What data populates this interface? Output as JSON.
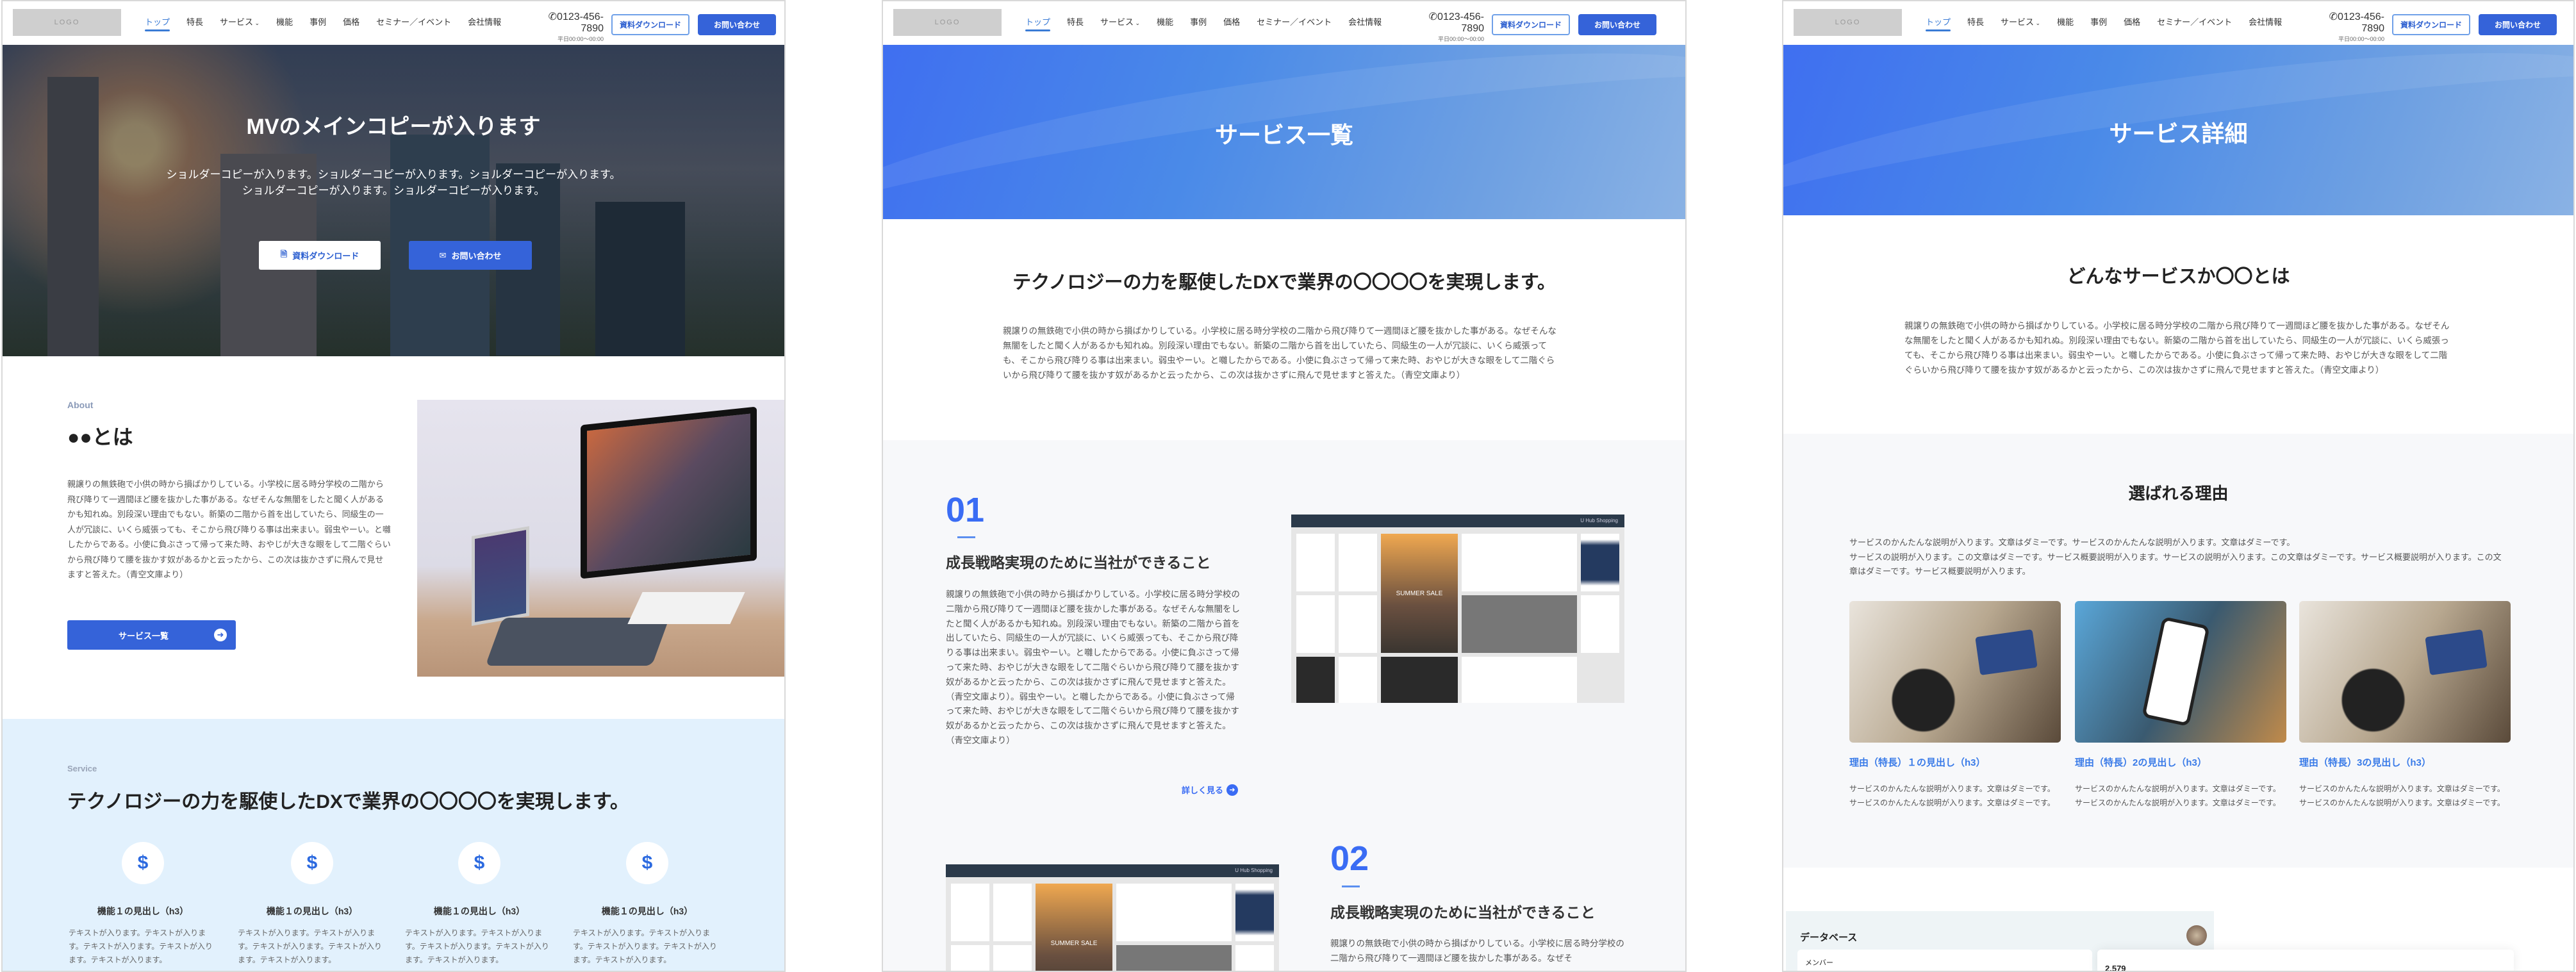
{
  "header": {
    "logo": "LOGO",
    "nav": [
      "トップ",
      "特長",
      "サービス",
      "機能",
      "事例",
      "価格",
      "セミナー／イベント",
      "会社情報"
    ],
    "active_nav": "トップ",
    "phone": "0123-456-7890",
    "hours": "平日00:00〜00:00",
    "download_label": "資料ダウンロード",
    "contact_label": "お問い合わせ",
    "accent": "#3563d9"
  },
  "top_page": {
    "hero": {
      "title": "MVのメインコピーが入ります",
      "sub1": "ショルダーコピーが入ります。ショルダーコピーが入ります。ショルダーコピーが入ります。",
      "sub2": "ショルダーコピーが入ります。ショルダーコピーが入ります。",
      "download_label": "資料ダウンロード",
      "contact_label": "お問い合わせ"
    },
    "about": {
      "eyebrow": "About",
      "title": "●●とは",
      "body": "親譲りの無鉄砲で小供の時から損ばかりしている。小学校に居る時分学校の二階から飛び降りて一週間ほど腰を抜かした事がある。なぜそんな無闇をしたと聞く人があるかも知れぬ。別段深い理由でもない。新築の二階から首を出していたら、同級生の一人が冗談に、いくら威張っても、そこから飛び降りる事は出来まい。弱虫やーい。と囃したからである。小使に負ぶさって帰って来た時、おやじが大きな眼をして二階ぐらいから飛び降りて腰を抜かす奴があるかと云ったから、この次は抜かさずに飛んで見せますと答えた。（青空文庫より）",
      "button": "サービス一覧"
    },
    "service": {
      "eyebrow": "Service",
      "title": "テクノロジーの力を駆使したDXで業界の〇〇〇〇を実現します。",
      "features": [
        {
          "title": "機能１の見出し（h3）",
          "text": "テキストが入ります。テキストが入ります。テキストが入ります。テキストが入ります。テキストが入ります。"
        },
        {
          "title": "機能１の見出し（h3）",
          "text": "テキストが入ります。テキストが入ります。テキストが入ります。テキストが入ります。テキストが入ります。"
        },
        {
          "title": "機能１の見出し（h3）",
          "text": "テキストが入ります。テキストが入ります。テキストが入ります。テキストが入ります。テキストが入ります。"
        },
        {
          "title": "機能１の見出し（h3）",
          "text": "テキストが入ります。テキストが入ります。テキストが入ります。テキストが入ります。テキストが入ります。"
        }
      ]
    }
  },
  "service_list": {
    "hero_title": "サービス一覧",
    "intro_title": "テクノロジーの力を駆使したDXで業界の〇〇〇〇を実現します。",
    "intro_body": "親譲りの無鉄砲で小供の時から損ばかりしている。小学校に居る時分学校の二階から飛び降りて一週間ほど腰を抜かした事がある。なぜそんな無闇をしたと聞く人があるかも知れぬ。別段深い理由でもない。新築の二階から首を出していたら、同級生の一人が冗談に、いくら威張っても、そこから飛び降りる事は出来まい。弱虫やーい。と囃したからである。小使に負ぶさって帰って来た時、おやじが大きな眼をして二階ぐらいから飛び降りて腰を抜かす奴があるかと云ったから、この次は抜かさずに飛んで見せますと答えた。（青空文庫より）",
    "items": [
      {
        "number": "01",
        "title": "成長戦略実現のために当社ができること",
        "body": "親譲りの無鉄砲で小供の時から損ばかりしている。小学校に居る時分学校の二階から飛び降りて一週間ほど腰を抜かした事がある。なぜそんな無闇をしたと聞く人があるかも知れぬ。別段深い理由でもない。新築の二階から首を出していたら、同級生の一人が冗談に、いくら威張っても、そこから飛び降りる事は出来まい。弱虫やーい。と囃したからである。小使に負ぶさって帰って来た時、おやじが大きな眼をして二階ぐらいから飛び降りて腰を抜かす奴があるかと云ったから、この次は抜かさずに飛んで見せますと答えた。（青空文庫より）。弱虫やーい。と囃したからである。小使に負ぶさって帰って来た時、おやじが大きな眼をして二階ぐらいから飛び降りて腰を抜かす奴があるかと云ったから、この次は抜かさずに飛んで見せますと答えた。（青空文庫より）",
        "more": "詳しく見る",
        "shop_brand": "U Hub Shopping",
        "shop_banner": "SUMMER SALE"
      },
      {
        "number": "02",
        "title": "成長戦略実現のために当社ができること",
        "body": "親譲りの無鉄砲で小供の時から損ばかりしている。小学校に居る時分学校の二階から飛び降りて一週間ほど腰を抜かした事がある。なぜそ",
        "shop_brand": "U Hub Shopping",
        "shop_banner": "SUMMER SALE"
      }
    ]
  },
  "service_detail": {
    "hero_title": "サービス詳細",
    "intro_title": "どんなサービスか〇〇とは",
    "intro_body": "親譲りの無鉄砲で小供の時から損ばかりしている。小学校に居る時分学校の二階から飛び降りて一週間ほど腰を抜かした事がある。なぜそんな無闇をしたと聞く人があるかも知れぬ。別段深い理由でもない。新築の二階から首を出していたら、同級生の一人が冗談に、いくら威張っても、そこから飛び降りる事は出来まい。弱虫やーい。と囃したからである。小使に負ぶさって帰って来た時、おやじが大きな眼をして二階ぐらいから飛び降りて腰を抜かす奴があるかと云ったから、この次は抜かさずに飛んで見せますと答えた。（青空文庫より）",
    "reasons_title": "選ばれる理由",
    "reasons_body1": "サービスのかんたんな説明が入ります。文章はダミーです。サービスのかんたんな説明が入ります。文章はダミーです。",
    "reasons_body2": "サービスの説明が入ります。この文章はダミーです。サービス概要説明が入ります。サービスの説明が入ります。この文章はダミーです。サービス概要説明が入ります。この文章はダミーです。サービス概要説明が入ります。",
    "reasons": [
      {
        "title": "理由（特長）１の見出し（h3）",
        "text": "サービスのかんたんな説明が入ります。文章はダミーです。サービスのかんたんな説明が入ります。文章はダミーです。"
      },
      {
        "title": "理由（特長）2の見出し（h3）",
        "text": "サービスのかんたんな説明が入ります。文章はダミーです。サービスのかんたんな説明が入ります。文章はダミーです。"
      },
      {
        "title": "理由（特長）3の見出し（h3）",
        "text": "サービスのかんたんな説明が入ります。文章はダミーです。サービスのかんたんな説明が入ります。文章はダミーです。"
      }
    ],
    "dashboard": {
      "title": "データベース",
      "members_label": "メンバー",
      "count": "2,579"
    }
  }
}
